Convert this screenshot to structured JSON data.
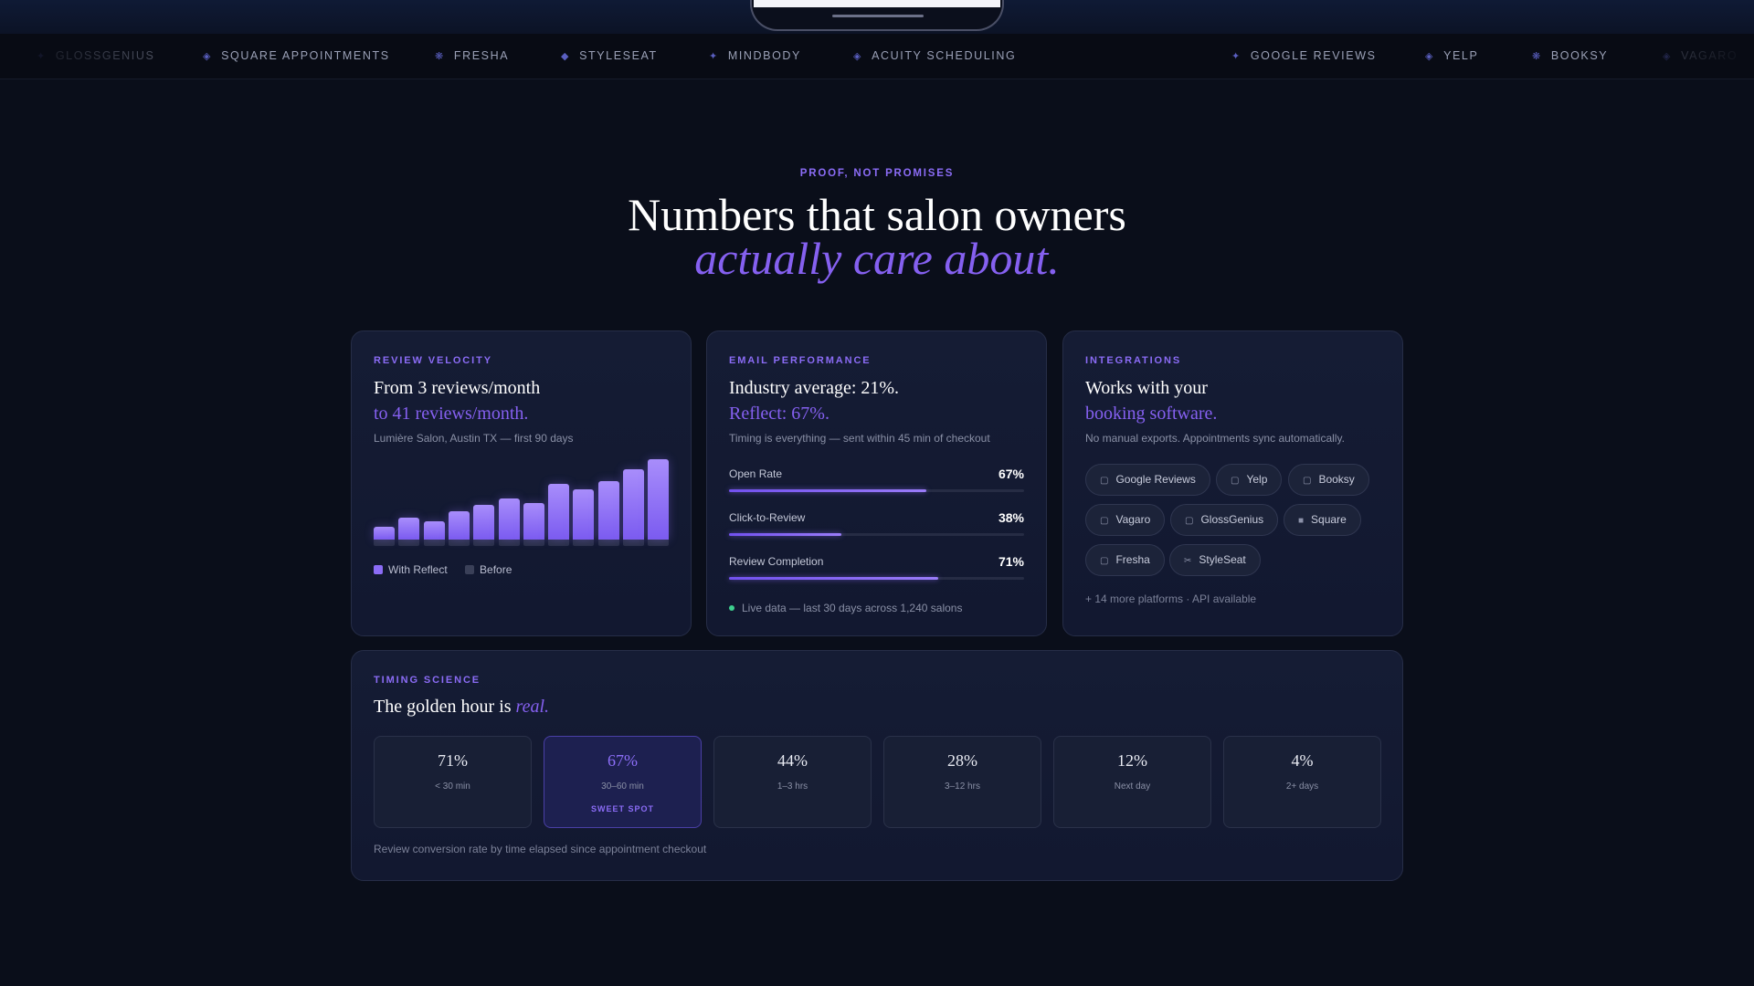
{
  "marquee": [
    {
      "icon": "sparkle-icon",
      "glyph": "✦",
      "label": "GlossGenius",
      "x": 40,
      "faded": true
    },
    {
      "icon": "diamond-icon",
      "glyph": "◈",
      "label": "Square Appointments",
      "x": 222
    },
    {
      "icon": "flower-icon",
      "glyph": "❋",
      "label": "Fresha",
      "x": 476
    },
    {
      "icon": "diamond-icon",
      "glyph": "◆",
      "label": "StyleSeat",
      "x": 614
    },
    {
      "icon": "sparkle-icon",
      "glyph": "✦",
      "label": "Mindbody",
      "x": 776
    },
    {
      "icon": "diamond-icon",
      "glyph": "◈",
      "label": "Acuity Scheduling",
      "x": 934
    },
    {
      "icon": "sparkle-icon",
      "glyph": "✦",
      "label": "Google Reviews",
      "x": 1348
    },
    {
      "icon": "diamond-icon",
      "glyph": "◈",
      "label": "Yelp",
      "x": 1560
    },
    {
      "icon": "flower-icon",
      "glyph": "❋",
      "label": "Booksy",
      "x": 1677
    },
    {
      "icon": "diamond-icon",
      "glyph": "◈",
      "label": "Vagaro",
      "x": 1820,
      "faded": true
    }
  ],
  "hero": {
    "eyebrow": "PROOF, NOT PROMISES",
    "title": "Numbers that salon owners",
    "accent": "actually care about."
  },
  "velocity": {
    "label": "REVIEW VELOCITY",
    "title": "From 3 reviews/month",
    "accent": "to 41 reviews/month.",
    "sub": "Lumière Salon, Austin TX — first 90 days",
    "legend_after": "With Reflect",
    "legend_before": "Before",
    "colors": {
      "after": "#8b6cf6",
      "before": "#3a4058"
    }
  },
  "chart_data": {
    "type": "bar",
    "categories": [
      "1",
      "2",
      "3",
      "4",
      "5",
      "6",
      "7",
      "8",
      "9",
      "10",
      "11",
      "12"
    ],
    "series": [
      {
        "name": "With Reflect",
        "values": [
          14,
          24,
          20,
          31,
          38,
          45,
          40,
          61,
          55,
          64,
          77,
          88
        ]
      },
      {
        "name": "Before",
        "values": [
          7,
          7,
          7,
          7,
          7,
          7,
          7,
          7,
          7,
          7,
          7,
          7
        ]
      }
    ],
    "ylim": [
      0,
      95
    ]
  },
  "email": {
    "label": "EMAIL PERFORMANCE",
    "title": "Industry average: 21%.",
    "accent": "Reflect: 67%.",
    "sub": "Timing is everything — sent within 45 min of checkout",
    "metrics": [
      {
        "name": "Open Rate",
        "value": "67%",
        "pct": 67
      },
      {
        "name": "Click-to-Review",
        "value": "38%",
        "pct": 38
      },
      {
        "name": "Review Completion",
        "value": "71%",
        "pct": 71
      }
    ],
    "live": "Live data — last 30 days across 1,240 salons"
  },
  "integrations": {
    "label": "INTEGRATIONS",
    "title": "Works with your",
    "accent": "booking software.",
    "sub": "No manual exports. Appointments sync automatically.",
    "chips": [
      {
        "label": "Google Reviews",
        "icon": "google-icon",
        "glyph": "▢"
      },
      {
        "label": "Yelp",
        "icon": "yelp-icon",
        "glyph": "▢"
      },
      {
        "label": "Booksy",
        "icon": "booksy-icon",
        "glyph": "▢"
      },
      {
        "label": "Vagaro",
        "icon": "vagaro-icon",
        "glyph": "▢"
      },
      {
        "label": "GlossGenius",
        "icon": "glossgenius-icon",
        "glyph": "▢"
      },
      {
        "label": "Square",
        "icon": "square-icon",
        "glyph": "■"
      },
      {
        "label": "Fresha",
        "icon": "fresha-icon",
        "glyph": "▢"
      },
      {
        "label": "StyleSeat",
        "icon": "scissors-icon",
        "glyph": "✂"
      }
    ],
    "more": "+ 14 more platforms · API available"
  },
  "timing": {
    "label": "TIMING SCIENCE",
    "title_plain": "The golden hour is ",
    "title_em": "real.",
    "tiles": [
      {
        "pct": "71%",
        "time": "< 30 min"
      },
      {
        "pct": "67%",
        "time": "30–60 min",
        "tag": "SWEET SPOT",
        "highlight": true
      },
      {
        "pct": "44%",
        "time": "1–3 hrs"
      },
      {
        "pct": "28%",
        "time": "3–12 hrs"
      },
      {
        "pct": "12%",
        "time": "Next day"
      },
      {
        "pct": "4%",
        "time": "2+ days"
      }
    ],
    "caption": "Review conversion rate by time elapsed since appointment checkout"
  }
}
